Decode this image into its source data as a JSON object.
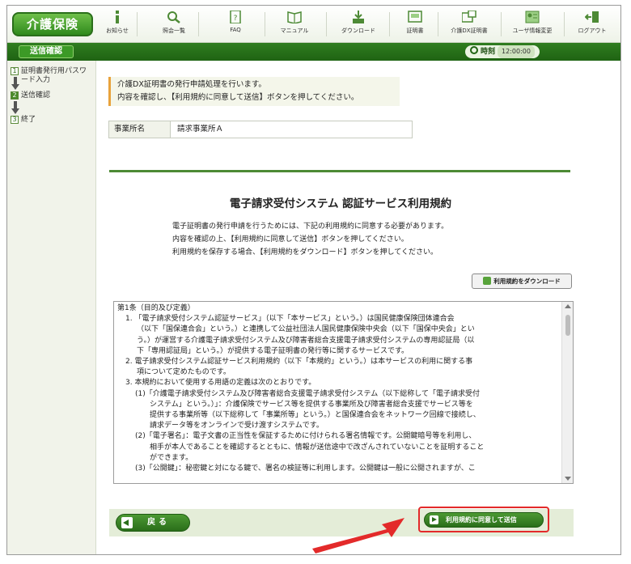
{
  "app": {
    "logo_text": "介護保険",
    "page_tag": "送信確認",
    "time_label": "時刻",
    "time_value": "12:00:00"
  },
  "nav": [
    {
      "label": "お知らせ",
      "icon": "info-icon"
    },
    {
      "label": "照会一覧",
      "icon": "search-icon"
    },
    {
      "label": "FAQ",
      "icon": "faq-icon"
    },
    {
      "label": "マニュアル",
      "icon": "manual-icon"
    },
    {
      "label": "ダウンロード",
      "icon": "download-icon"
    },
    {
      "label": "証明書",
      "icon": "certificate-icon"
    },
    {
      "label": "介護DX証明書",
      "icon": "dx-certificate-icon"
    },
    {
      "label": "ユーザ情報変更",
      "icon": "user-info-icon"
    },
    {
      "label": "ログアウト",
      "icon": "logout-icon"
    }
  ],
  "sidebar": {
    "steps": [
      {
        "num": "1",
        "label": "証明書発行用パスワード入力"
      },
      {
        "num": "2",
        "label": "送信確認"
      },
      {
        "num": "3",
        "label": "終了"
      }
    ]
  },
  "main": {
    "message_line1": "介護DX証明書の発行申請処理を行います。",
    "message_line2": "内容を確認し、【利用規約に同意して送信】ボタンを押してください。",
    "office_label": "事業所名",
    "office_value": "請求事業所Ａ",
    "terms_title": "電子請求受付システム 認証サービス利用規約",
    "intro_line1": "電子証明書の発行申請を行うためには、下記の利用規約に同意する必要があります。",
    "intro_line2": "内容を確認の上、【利用規約に同意して送信】ボタンを押してください。",
    "intro_line3": "利用規約を保存する場合、【利用規約をダウンロード】ボタンを押してください。",
    "download_label": "利用規約をダウンロード",
    "terms_lines": [
      "第1条（目的及び定義）",
      "1. 「電子請求受付システム認証サービス」（以下「本サービス」という。）は国民健康保険団体連合会",
      "（以下「国保連合会」という。）と連携して公益社団法人国民健康保険中央会（以下「国保中央会」とい",
      "う。）が運営する介護電子請求受付システム及び障害者総合支援電子請求受付システムの専用認証局（以",
      "下「専用認証局」という。）が提供する電子証明書の発行等に関するサービスです。",
      "2. 電子請求受付システム認証サービス利用規約（以下「本規約」という。）は本サービスの利用に関する事",
      "項について定めたものです。",
      "3. 本規約において使用する用語の定義は次のとおりです。",
      "(1)「介護電子請求受付システム及び障害者総合支援電子請求受付システム（以下総称して「電子請求受付",
      "システム」という。）」：介護保険でサービス等を提供する事業所及び障害者総合支援でサービス等を",
      "提供する事業所等（以下総称して「事業所等」という。）と国保連合会をネットワーク回線で接続し、",
      "請求データ等をオンラインで受け渡すシステムです。",
      "(2)「電子署名」：電子文書の正当性を保証するために付けられる署名情報です。公開鍵暗号等を利用し、",
      "相手が本人であることを確認するとともに、情報が送信途中で改ざんされていないことを証明すること",
      "ができます。",
      "(3)「公開鍵」：秘密鍵と対になる鍵で、署名の検証等に利用します。公開鍵は一般に公開されますが、こ"
    ],
    "back_label": "戻る",
    "agree_label": "利用規約に同意して送信"
  }
}
